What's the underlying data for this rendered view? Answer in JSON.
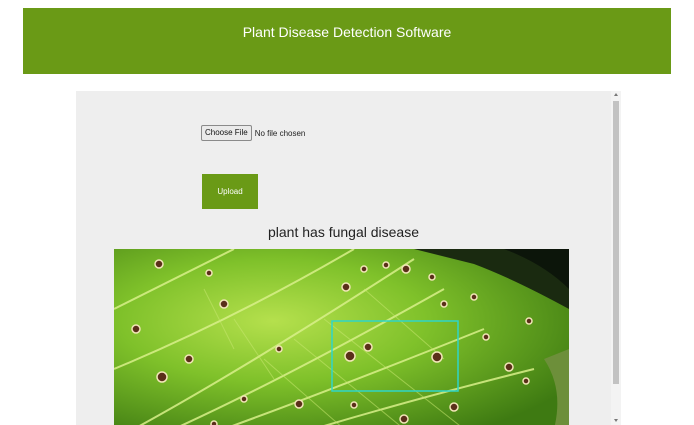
{
  "header": {
    "title": "Plant Disease Detection Software",
    "background_color": "#6a9a16"
  },
  "form": {
    "choose_file_label": "Choose File",
    "file_status": "No file chosen",
    "upload_label": "Upload"
  },
  "result": {
    "text": "plant has fungal disease"
  },
  "image": {
    "icon": "leaf-image",
    "detection_box_color": "#2fd6c8"
  }
}
